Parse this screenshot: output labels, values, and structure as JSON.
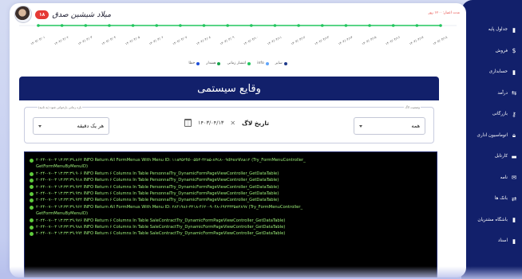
{
  "header": {
    "username": "میلاد شیشین صدق",
    "badge": "۱۸",
    "expiry_text": "مدت اعتبار: ۱۲۰۰ روز"
  },
  "sidebar": {
    "items": [
      {
        "label": "جداول پایه",
        "icon": "file-icon"
      },
      {
        "label": "فروش",
        "icon": "dollar-icon"
      },
      {
        "label": "حسابداری",
        "icon": "file-icon"
      },
      {
        "label": "درآمد",
        "icon": "income-icon"
      },
      {
        "label": "بازرگانی",
        "icon": "key-icon"
      },
      {
        "label": "اتوماسیون اداری",
        "icon": "lock-icon"
      },
      {
        "label": "کارتابل",
        "icon": "folder-icon"
      },
      {
        "label": "نامه",
        "icon": "mail-icon"
      },
      {
        "label": "بانک ها",
        "icon": "bank-icon"
      },
      {
        "label": "باشگاه مشتریان",
        "icon": "file-icon"
      },
      {
        "label": "اسناد",
        "icon": "file-icon"
      }
    ]
  },
  "chart_data": {
    "type": "line",
    "title": "",
    "series": [
      {
        "name": "سایر",
        "values": [
          0,
          0,
          0,
          0,
          0,
          0,
          0,
          0,
          0,
          0,
          0,
          0,
          0,
          0,
          0,
          0,
          0,
          0
        ],
        "color": "#22c55e"
      },
      {
        "name": "انتشار زمانی",
        "values": [
          0,
          0,
          0,
          0,
          0,
          0,
          0,
          0,
          0,
          0,
          0,
          0,
          0,
          0,
          0,
          0,
          0,
          0
        ],
        "color": "#22c55e"
      },
      {
        "name": "هشدار",
        "values": [
          0,
          0,
          0,
          0,
          0,
          0,
          0,
          0,
          0,
          0,
          0,
          0,
          0,
          0,
          0,
          0,
          0,
          0
        ],
        "color": "#16a34a"
      },
      {
        "name": "خطا",
        "values": [
          0,
          0,
          0,
          0,
          0,
          0,
          0,
          0,
          0,
          0,
          0,
          0,
          0,
          0,
          0,
          0,
          0,
          0
        ],
        "color": "#1e3a8a"
      }
    ],
    "x": [
      "۱۴۰۳/۰۴/۰۱",
      "۱۴۰۳/۰۴/۰۲",
      "۱۴۰۳/۰۴/۰۳",
      "۱۴۰۳/۰۴/۰۴",
      "۱۴۰۳/۰۴/۰۵",
      "۱۴۰۳/۰۴/۰۶",
      "۱۴۰۳/۰۴/۰۷",
      "۱۴۰۳/۰۴/۰۸",
      "۱۴۰۳/۰۴/۰۹",
      "۱۴۰۳/۰۴/۱۰",
      "۱۴۰۳/۰۴/۱۱",
      "۱۴۰۳/۰۴/۱۲",
      "۱۴۰۳/۰۴/۱۳",
      "۱۴۰۳/۰۴/۱۴",
      "۱۴۰۳/۰۴/۱۵",
      "۱۴۰۳/۰۴/۱۶",
      "۱۴۰۳/۰۴/۱۷",
      "۱۴۰۳/۰۴/۱۸"
    ],
    "legend_position": "bottom",
    "legend": [
      {
        "label": "سایر",
        "color": "#1e3a8a"
      },
      {
        "label": "info",
        "color": "#60a5fa"
      },
      {
        "label": "انتشار زمانی",
        "color": "#22c55e"
      },
      {
        "label": "هشدار",
        "color": "#16a34a"
      },
      {
        "label": "خطا",
        "color": "#1d4ed8"
      }
    ]
  },
  "events": {
    "title": "وقایع سیستمی",
    "level_label": "وضعیت لاگ",
    "level_value": "همه",
    "date_label": "تاریخ لاگ",
    "date_value": "۱۴۰۳/۰۴/۱۳",
    "refresh_label": "بازه زمانی بازخوانی شود (به ثانیه)",
    "refresh_value": "هر یک دقیقه"
  },
  "logs": [
    {
      "text": "۲۰۲۴-۰۷-۰۳ ۱۳:۳۳:۳۹.۸۶۲ INFO Return All FormMenus With Menu ID: ۱۱a۳۵۲fd-۰۵b۴-۴۲a۵-۸۳c۸-۰۹d۲e۸۹f۸a۱۲ (Try_FormMenuController_",
      "cont": "GetFormMenuByMenuID)"
    },
    {
      "text": "۲۰۲۴-۰۷-۰۳ ۱۳:۳۳:۳۹.۹۰۶ INFO Return ۶ Columns In Table PersonnalTry_DynamicFormPageViewController_GetDataTable)"
    },
    {
      "text": "۲۰۲۴-۰۷-۰۳ ۱۳:۳۳:۳۹.۹۱۸ INFO Return ۶ Columns In Table PersonnalTry_DynamicFormPageViewController_GetDataTable)"
    },
    {
      "text": "۲۰۲۴-۰۷-۰۳ ۱۳:۳۳:۳۹.۹۲۴ INFO Return ۶ Columns In Table PersonnalTry_DynamicFormPageViewController_GetDataTable)"
    },
    {
      "text": "۲۰۲۴-۰۷-۰۳ ۱۳:۳۳:۳۹.۹۳۸ INFO Return ۶ Columns In Table PersonnalTry_DynamicFormPageViewController_GetDataTable)"
    },
    {
      "text": "۲۰۲۴-۰۷-۰۳ ۱۳:۳۳:۳۹.۹۴۴ INFO Return ۶ Columns In Table PersonnalTry_DynamicFormPageViewController_GetDataTable)"
    },
    {
      "text": "۲۰۲۴-۰۷-۰۳ ۱۳:۳۳:۳۹.۹۶۲ INFO Return All FormMenus With Menu ID: ۲۸۴۱۹۸۶-۳۲۱۸-۴۶۲۰-۹۰۴۸-۶۹۲۳۳۳۵e۲۸۹۷ (Try_FormMenuController_",
      "cont": "GetFormMenuByMenuID)"
    },
    {
      "text": "۲۰۲۴-۰۷-۰۳ ۱۳:۳۳:۳۹.۹۷۶ INFO Return ۶ Columns In Table SaleContractTry_DynamicFormPageViewController_GetDataTable)"
    },
    {
      "text": "۲۰۲۴-۰۷-۰۳ ۱۳:۳۳:۳۹.۹۸۸ INFO Return ۶ Columns In Table SaleContractTry_DynamicFormPageViewController_GetDataTable)"
    },
    {
      "text": "۲۰۲۴-۰۷-۰۳ ۱۳:۳۳:۳۹.۹۹۴ INFO Return ۶ Columns In Table SaleContractTry_DynamicFormPageViewController_GetDataTable)"
    }
  ]
}
